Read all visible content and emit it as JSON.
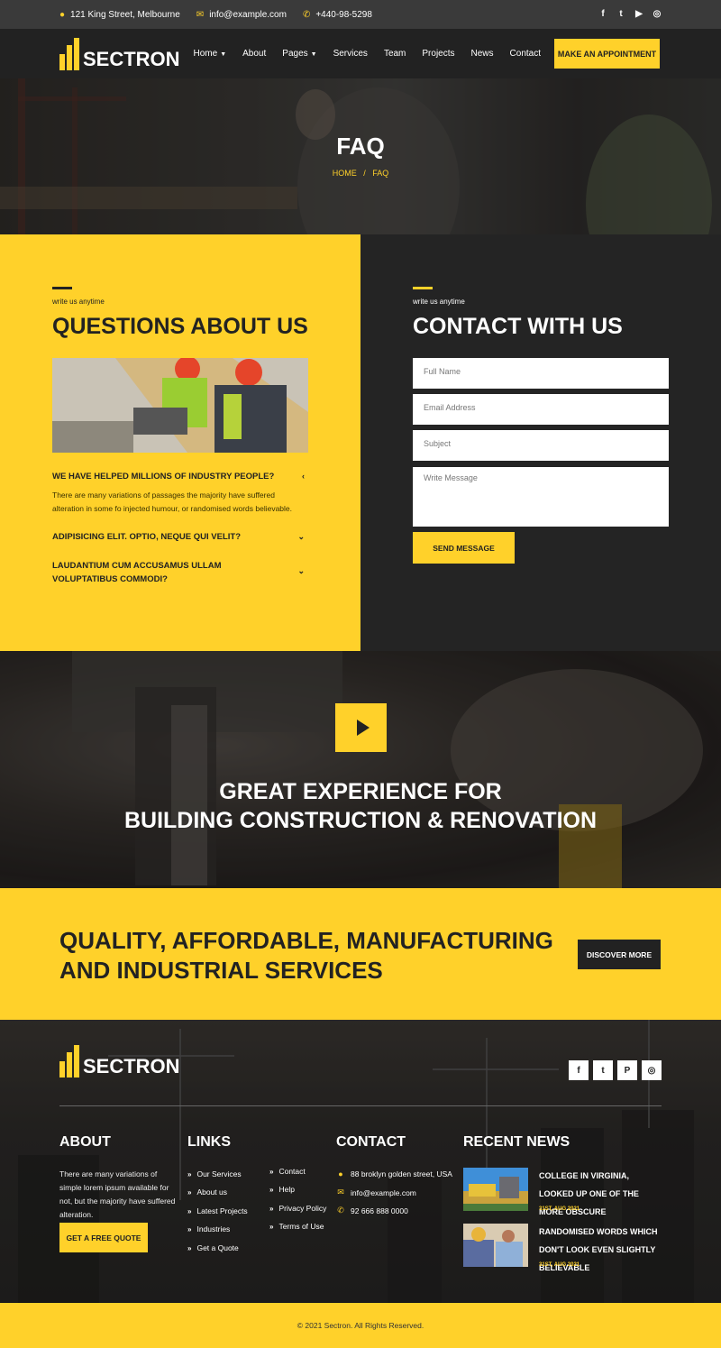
{
  "topbar": {
    "address": "121 King Street, Melbourne",
    "email": "info@example.com",
    "phone": "+440-98-5298",
    "social": [
      "facebook-icon",
      "twitter-icon",
      "youtube-icon",
      "instagram-icon"
    ]
  },
  "brand": {
    "name": "SECTRON",
    "accent": "#ffd12a",
    "dark": "#222222"
  },
  "nav": {
    "items": [
      {
        "label": "Home",
        "dropdown": true
      },
      {
        "label": "About",
        "dropdown": false
      },
      {
        "label": "Pages",
        "dropdown": true
      },
      {
        "label": "Services",
        "dropdown": false
      },
      {
        "label": "Team",
        "dropdown": false
      },
      {
        "label": "Projects",
        "dropdown": false
      },
      {
        "label": "News",
        "dropdown": false
      },
      {
        "label": "Contact",
        "dropdown": false
      }
    ],
    "cta": "MAKE AN APPOINTMENT"
  },
  "hero": {
    "title": "FAQ",
    "breadcrumb_home": "HOME",
    "breadcrumb_sep": "/",
    "breadcrumb_current": "FAQ"
  },
  "faq": {
    "kicker": "write us anytime",
    "heading": "QUESTIONS ABOUT US",
    "items": [
      {
        "question": "WE HAVE HELPED MILLIONS OF INDUSTRY PEOPLE?",
        "answer": "There are many variations of passages the majority have suffered alteration in some fo injected humour, or randomised words believable.",
        "expanded": true
      },
      {
        "question": "ADIPISICING ELIT. OPTIO, NEQUE QUI VELIT?",
        "expanded": false
      },
      {
        "question": "LAUDANTIUM CUM ACCUSAMUS ULLAM VOLUPTATIBUS COMMODI?",
        "expanded": false
      }
    ]
  },
  "contact_form": {
    "kicker": "write us anytime",
    "heading": "CONTACT WITH US",
    "name_placeholder": "Full Name",
    "email_placeholder": "Email Address",
    "subject_placeholder": "Subject",
    "message_placeholder": "Write Message",
    "submit": "SEND MESSAGE"
  },
  "video": {
    "line1": "GREAT EXPERIENCE FOR",
    "line2": "BUILDING CONSTRUCTION & RENOVATION"
  },
  "cta": {
    "line1": "QUALITY, AFFORDABLE, MANUFACTURING",
    "line2": "AND INDUSTRIAL SERVICES",
    "button": "DISCOVER MORE"
  },
  "footer": {
    "social": [
      "facebook-icon",
      "twitter-icon",
      "pinterest-icon",
      "instagram-icon"
    ],
    "about": {
      "heading": "ABOUT",
      "text": "There are many variations of simple lorem ipsum available for not, but the majority have suffered alteration.",
      "button": "GET A FREE QUOTE"
    },
    "links": {
      "heading": "LINKS",
      "col1": [
        "Our Services",
        "About us",
        "Latest Projects",
        "Industries",
        "Get a Quote"
      ],
      "col2": [
        "Contact",
        "Help",
        "Privacy Policy",
        "Terms of Use"
      ]
    },
    "contact": {
      "heading": "CONTACT",
      "address": "88 broklyn golden street, USA",
      "email": "info@example.com",
      "phone": "92 666 888 0000"
    },
    "news": {
      "heading": "RECENT NEWS",
      "items": [
        {
          "title": "COLLEGE IN VIRGINIA, LOOKED UP ONE OF THE MORE OBSCURE",
          "date": "31ST, AUG 2021"
        },
        {
          "title": "RANDOMISED WORDS WHICH DON'T LOOK EVEN SLIGHTLY BELIEVABLE",
          "date": "31ST, AUG 2021"
        }
      ]
    },
    "copyright": "© 2021 Sectron. All Rights Reserved."
  }
}
